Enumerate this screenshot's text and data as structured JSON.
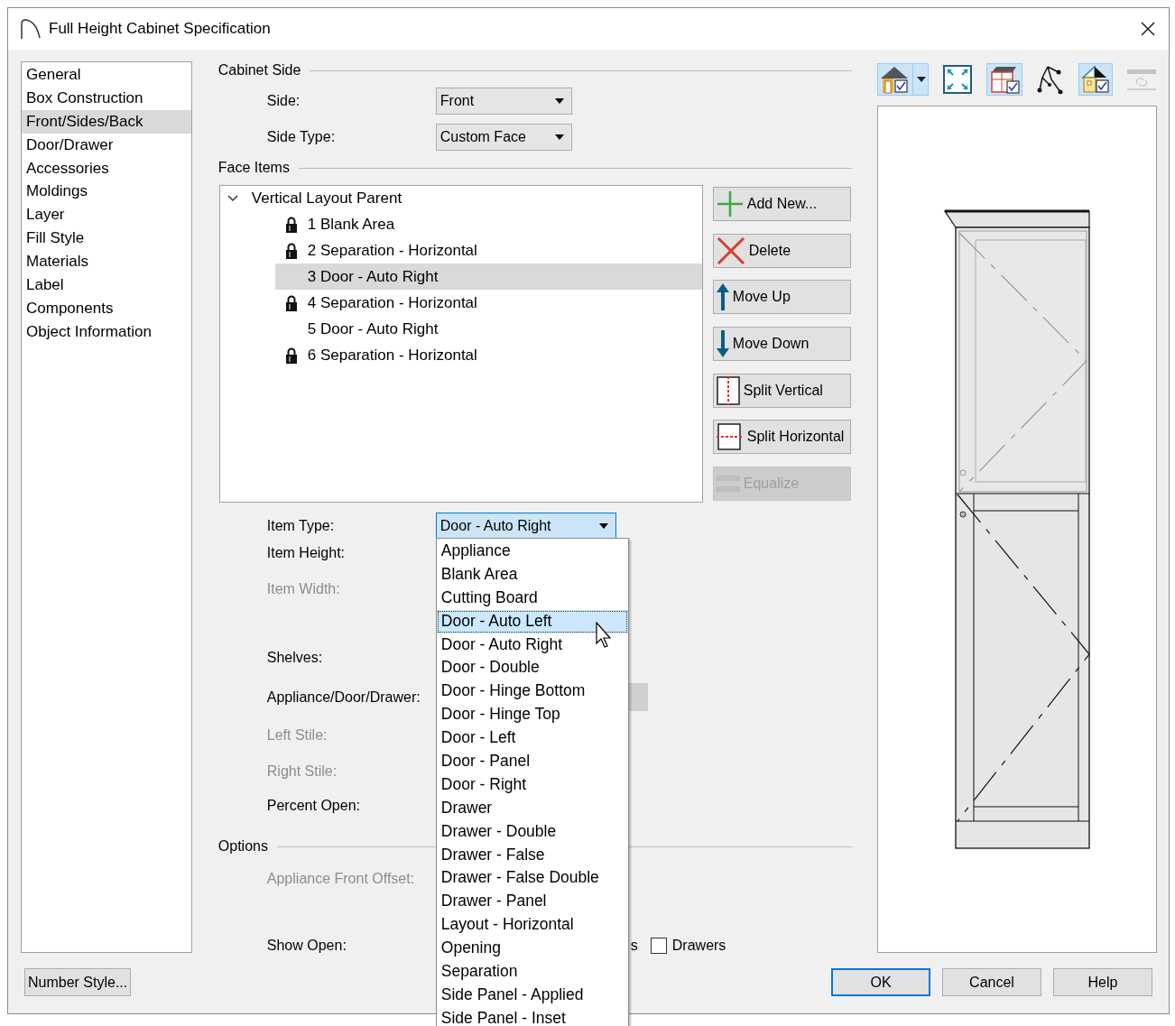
{
  "window": {
    "title": "Full Height Cabinet Specification"
  },
  "sidebar": {
    "items": [
      {
        "label": "General",
        "selected": false
      },
      {
        "label": "Box Construction",
        "selected": false
      },
      {
        "label": "Front/Sides/Back",
        "selected": true
      },
      {
        "label": "Door/Drawer",
        "selected": false
      },
      {
        "label": "Accessories",
        "selected": false
      },
      {
        "label": "Moldings",
        "selected": false
      },
      {
        "label": "Layer",
        "selected": false
      },
      {
        "label": "Fill Style",
        "selected": false
      },
      {
        "label": "Materials",
        "selected": false
      },
      {
        "label": "Label",
        "selected": false
      },
      {
        "label": "Components",
        "selected": false
      },
      {
        "label": "Object Information",
        "selected": false
      }
    ]
  },
  "cabinet_side": {
    "title": "Cabinet Side",
    "fields": [
      {
        "label": "Side:",
        "value": "Front"
      },
      {
        "label": "Side Type:",
        "value": "Custom Face"
      }
    ]
  },
  "face_items": {
    "title": "Face Items",
    "tree": {
      "label": "Vertical Layout Parent",
      "expanded": true,
      "children": [
        {
          "label": "1 Blank Area",
          "locked": true,
          "selected": false
        },
        {
          "label": "2 Separation - Horizontal",
          "locked": true,
          "selected": false
        },
        {
          "label": "3 Door - Auto Right",
          "locked": false,
          "selected": true
        },
        {
          "label": "4 Separation - Horizontal",
          "locked": true,
          "selected": false
        },
        {
          "label": "5 Door - Auto Right",
          "locked": false,
          "selected": false
        },
        {
          "label": "6 Separation - Horizontal",
          "locked": true,
          "selected": false
        }
      ]
    },
    "buttons": [
      {
        "label": "Add New...",
        "kind": "add",
        "disabled": false
      },
      {
        "label": "Delete",
        "kind": "delete",
        "disabled": false
      },
      {
        "label": "Move Up",
        "kind": "up",
        "disabled": false
      },
      {
        "label": "Move Down",
        "kind": "down",
        "disabled": false
      },
      {
        "label": "Split Vertical",
        "kind": "split-vertical",
        "disabled": false
      },
      {
        "label": "Split Horizontal",
        "kind": "split-horizontal",
        "disabled": false
      },
      {
        "label": "Equalize",
        "kind": "equalize",
        "disabled": true
      }
    ]
  },
  "item_type": {
    "label": "Item Type:",
    "value": "Door - Auto Right",
    "expanded": true,
    "options": [
      {
        "label": "Appliance",
        "highlighted": false
      },
      {
        "label": "Blank Area",
        "highlighted": false
      },
      {
        "label": "Cutting Board",
        "highlighted": false
      },
      {
        "label": "Door - Auto Left",
        "highlighted": true
      },
      {
        "label": "Door - Auto Right",
        "highlighted": false
      },
      {
        "label": "Door - Double",
        "highlighted": false
      },
      {
        "label": "Door - Hinge Bottom",
        "highlighted": false
      },
      {
        "label": "Door - Hinge Top",
        "highlighted": false
      },
      {
        "label": "Door - Left",
        "highlighted": false
      },
      {
        "label": "Door - Panel",
        "highlighted": false
      },
      {
        "label": "Door - Right",
        "highlighted": false
      },
      {
        "label": "Drawer",
        "highlighted": false
      },
      {
        "label": "Drawer - Double",
        "highlighted": false
      },
      {
        "label": "Drawer - False",
        "highlighted": false
      },
      {
        "label": "Drawer - False Double",
        "highlighted": false
      },
      {
        "label": "Drawer - Panel",
        "highlighted": false
      },
      {
        "label": "Layout - Horizontal",
        "highlighted": false
      },
      {
        "label": "Opening",
        "highlighted": false
      },
      {
        "label": "Separation",
        "highlighted": false
      },
      {
        "label": "Side Panel - Applied",
        "highlighted": false
      },
      {
        "label": "Side Panel - Inset",
        "highlighted": false
      }
    ]
  },
  "item_fields": [
    {
      "label": "Item Height:",
      "disabled": false
    },
    {
      "label": "Item Width:",
      "disabled": true
    },
    {
      "label": "Shelves:",
      "disabled": false
    },
    {
      "label": "Appliance/Door/Drawer:",
      "disabled": false
    },
    {
      "label": "Left Stile:",
      "disabled": true
    },
    {
      "label": "Right Stile:",
      "disabled": true
    },
    {
      "label": "Percent Open:",
      "disabled": false
    }
  ],
  "options": {
    "title": "Options",
    "fields": [
      {
        "label": "Appliance Front Offset:",
        "disabled": true
      },
      {
        "label": "Show Open:",
        "disabled": false
      }
    ],
    "show_open_partial_label": "s",
    "checkbox": {
      "label": "Drawers",
      "checked": false
    }
  },
  "preview_tools": [
    {
      "kind": "house",
      "selected": true,
      "has_menu": true,
      "disabled": false
    },
    {
      "kind": "fill-window",
      "selected": false,
      "has_menu": false,
      "disabled": false
    },
    {
      "kind": "cabinet",
      "selected": true,
      "has_menu": false,
      "disabled": false
    },
    {
      "kind": "path",
      "selected": false,
      "has_menu": false,
      "disabled": false
    },
    {
      "kind": "house-section",
      "selected": true,
      "has_menu": false,
      "disabled": false
    },
    {
      "kind": "refresh",
      "selected": false,
      "has_menu": false,
      "disabled": true
    }
  ],
  "footer": {
    "left_button": "Number Style...",
    "buttons": [
      {
        "label": "OK",
        "default": true
      },
      {
        "label": "Cancel",
        "default": false
      },
      {
        "label": "Help",
        "default": false
      }
    ]
  }
}
